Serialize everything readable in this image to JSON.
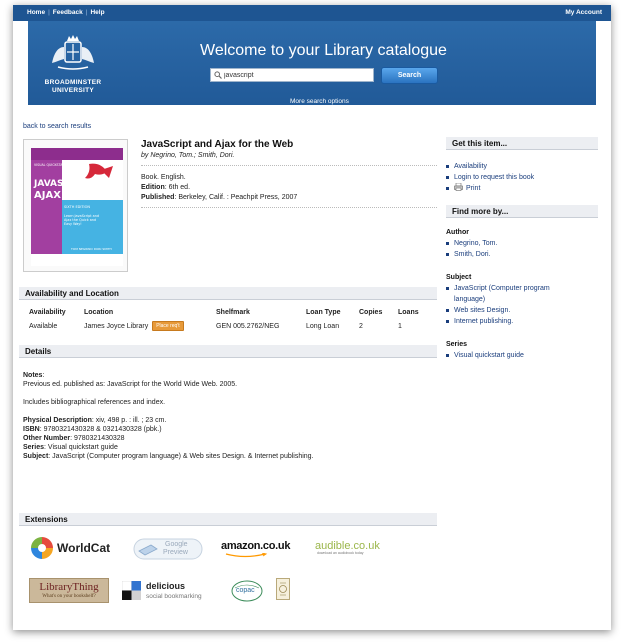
{
  "topnav": {
    "home": "Home",
    "feedback": "Feedback",
    "help": "Help",
    "separator": "|",
    "my_account": "My Account"
  },
  "banner": {
    "university_line1": "BROADMINSTER",
    "university_line2": "UNIVERSITY",
    "welcome": "Welcome to your Library catalogue",
    "search_value": "javascript",
    "search_button": "Search",
    "more_options": "More search options"
  },
  "back_link": "back to search results",
  "book": {
    "title": "JavaScript and Ajax for the Web",
    "authors": "by Negrino, Tom.; Smith, Dori.",
    "format": "Book. English.",
    "edition_label": "Edition",
    "edition": ": 6th ed.",
    "published_label": "Published",
    "published": ": Berkeley, Calif. : Peachpit Press, 2007",
    "cover": {
      "series": "VISUAL QUICKSTART GUIDE",
      "title1": "JAVASCRIPT &",
      "title2": "AJAX",
      "edition": "SIXTH EDITION",
      "blurb": "Learn JavaScript and Ajax the Quick and Easy Way!",
      "authors": "TOM NEGRINO  DORI SMITH"
    }
  },
  "availability": {
    "heading": "Availability and Location",
    "columns": [
      "Availability",
      "Location",
      "Shelfmark",
      "Loan Type",
      "Copies",
      "Loans"
    ],
    "row": {
      "availability": "Available",
      "location": "James Joyce Library",
      "place_btn": "Place req't",
      "shelfmark": "GEN 005.2762/NEG",
      "loan_type": "Long Loan",
      "copies": "2",
      "loans": "1"
    }
  },
  "details": {
    "heading": "Details",
    "notes_label": "Notes",
    "notes_1": "Previous ed. published as: JavaScript for the World Wide Web. 2005.",
    "notes_2": "Includes bibliographical references and index.",
    "physical_label": "Physical Description",
    "physical": ": xiv, 498 p. : ill. ; 23 cm.",
    "isbn_label": "ISBN",
    "isbn": ": 9780321430328 & 0321430328 (pbk.)",
    "other_label": "Other Number",
    "other": ": 9780321430328",
    "series_label": "Series",
    "series": ": Visual quickstart guide",
    "subject_label": "Subject",
    "subject": ": JavaScript (Computer program language) & Web sites Design. & Internet publishing."
  },
  "extensions": {
    "heading": "Extensions",
    "worldcat": "WorldCat",
    "google_preview_1": "Google",
    "google_preview_2": "Preview",
    "amazon": "amazon.co.uk",
    "audible": "audible.co.uk",
    "audible_sub": "download an audiobook today",
    "librarything": "LibraryThing",
    "librarything_sub": "What's on your bookshelf?",
    "delicious": "delicious",
    "delicious_sub": "social bookmarking",
    "copac": "copac"
  },
  "sidebar": {
    "get_heading": "Get this item...",
    "get_items": [
      "Availability",
      "Login to request this book",
      "Print"
    ],
    "find_heading": "Find more by...",
    "author_label": "Author",
    "authors": [
      "Negrino, Tom.",
      "Smith, Dori."
    ],
    "subject_label": "Subject",
    "subject_1a": "JavaScript (Computer program",
    "subject_1b": "language)",
    "subjects_rest": [
      "Web sites Design.",
      "Internet publishing."
    ],
    "series_label": "Series",
    "series": [
      "Visual quickstart guide"
    ]
  },
  "colors": {
    "banner": "#2c6aa9",
    "topbar": "#1e5592",
    "link": "#1a3d7c",
    "section_bg": "#eceef2"
  }
}
